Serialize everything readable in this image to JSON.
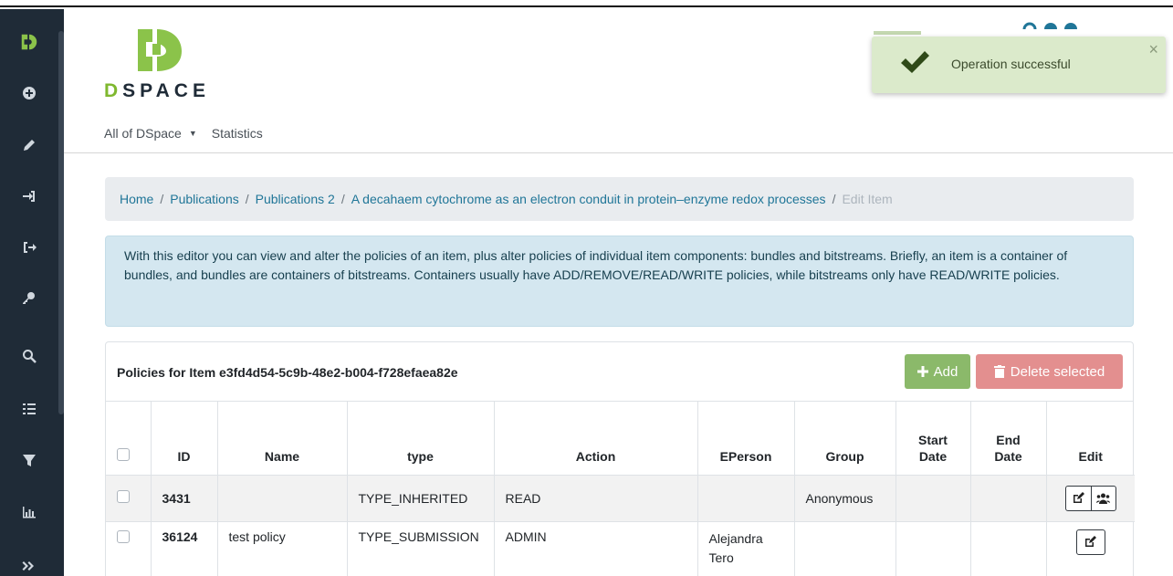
{
  "brand": {
    "name": "DSPACE",
    "accent": "#7fb82f"
  },
  "sidebar": {
    "items": [
      "dspace-logo-icon",
      "plus-circle-icon",
      "pencil-icon",
      "sign-in-icon",
      "sign-out-icon",
      "key-icon",
      "search-icon",
      "list-icon",
      "filter-icon",
      "chart-icon",
      "expand-icon"
    ]
  },
  "nav": {
    "all_of_dspace": "All of DSpace",
    "statistics": "Statistics"
  },
  "toast": {
    "message": "Operation successful",
    "close": "×"
  },
  "breadcrumb": {
    "home": "Home",
    "publications": "Publications",
    "publications2": "Publications 2",
    "item": "A decahaem cytochrome as an electron conduit in protein–enzyme redox processes",
    "current": "Edit Item",
    "sep": "/"
  },
  "info": {
    "text": "With this editor you can view and alter the policies of an item, plus alter policies of individual item components: bundles and bitstreams. Briefly, an item is a container of bundles, and bundles are containers of bitstreams. Containers usually have ADD/REMOVE/READ/WRITE policies, while bitstreams only have READ/WRITE policies."
  },
  "policies": {
    "title": "Policies for Item e3fd4d54-5c9b-48e2-b004-f728efaea82e",
    "add_label": "Add",
    "delete_label": "Delete selected",
    "columns": {
      "id": "ID",
      "name": "Name",
      "type": "type",
      "action": "Action",
      "eperson": "EPerson",
      "group": "Group",
      "start_date": "Start Date",
      "end_date": "End Date",
      "edit": "Edit"
    },
    "rows": [
      {
        "id": "3431",
        "name": "",
        "type": "TYPE_INHERITED",
        "action": "READ",
        "eperson": "",
        "group": "Anonymous",
        "start_date": "",
        "end_date": ""
      },
      {
        "id": "36124",
        "name": "test policy",
        "type": "TYPE_SUBMISSION",
        "action": "ADMIN",
        "eperson": "Alejandra Tero",
        "group": "",
        "start_date": "",
        "end_date": ""
      }
    ]
  }
}
